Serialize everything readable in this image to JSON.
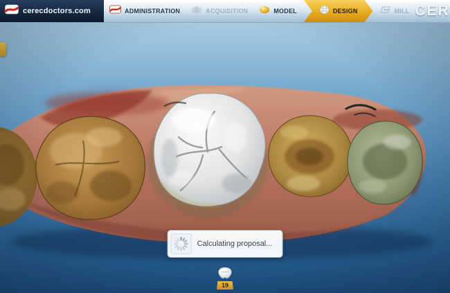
{
  "header": {
    "logo_text": "cerecdoctors.com",
    "brand_text": "CERE",
    "tabs": [
      {
        "label": "ADMINISTRATION",
        "state": "enabled"
      },
      {
        "label": "ACQUISITION",
        "state": "disabled"
      },
      {
        "label": "MODEL",
        "state": "enabled"
      },
      {
        "label": "DESIGN",
        "state": "active"
      },
      {
        "label": "MILL",
        "state": "disabled"
      }
    ]
  },
  "viewport": {
    "progress": {
      "message": "Calculating proposal..."
    },
    "tooth_indicator": {
      "number": "19"
    }
  },
  "colors": {
    "header_navy": "#16263f",
    "active_tab_gold": "#e7ac22",
    "background_top": "#a9cde4",
    "background_bottom": "#1c4d7c",
    "crown_white": "#e6e7e8",
    "gum_pink": "#b97662"
  },
  "icons": {
    "logo": "cerecdoctors-logo-icon",
    "administration": "administration-icon",
    "acquisition": "camera-icon",
    "model": "model-icon",
    "design": "design-tooth-icon",
    "mill": "mill-icon",
    "spinner": "spinner-icon",
    "tooth": "tooth-icon"
  }
}
